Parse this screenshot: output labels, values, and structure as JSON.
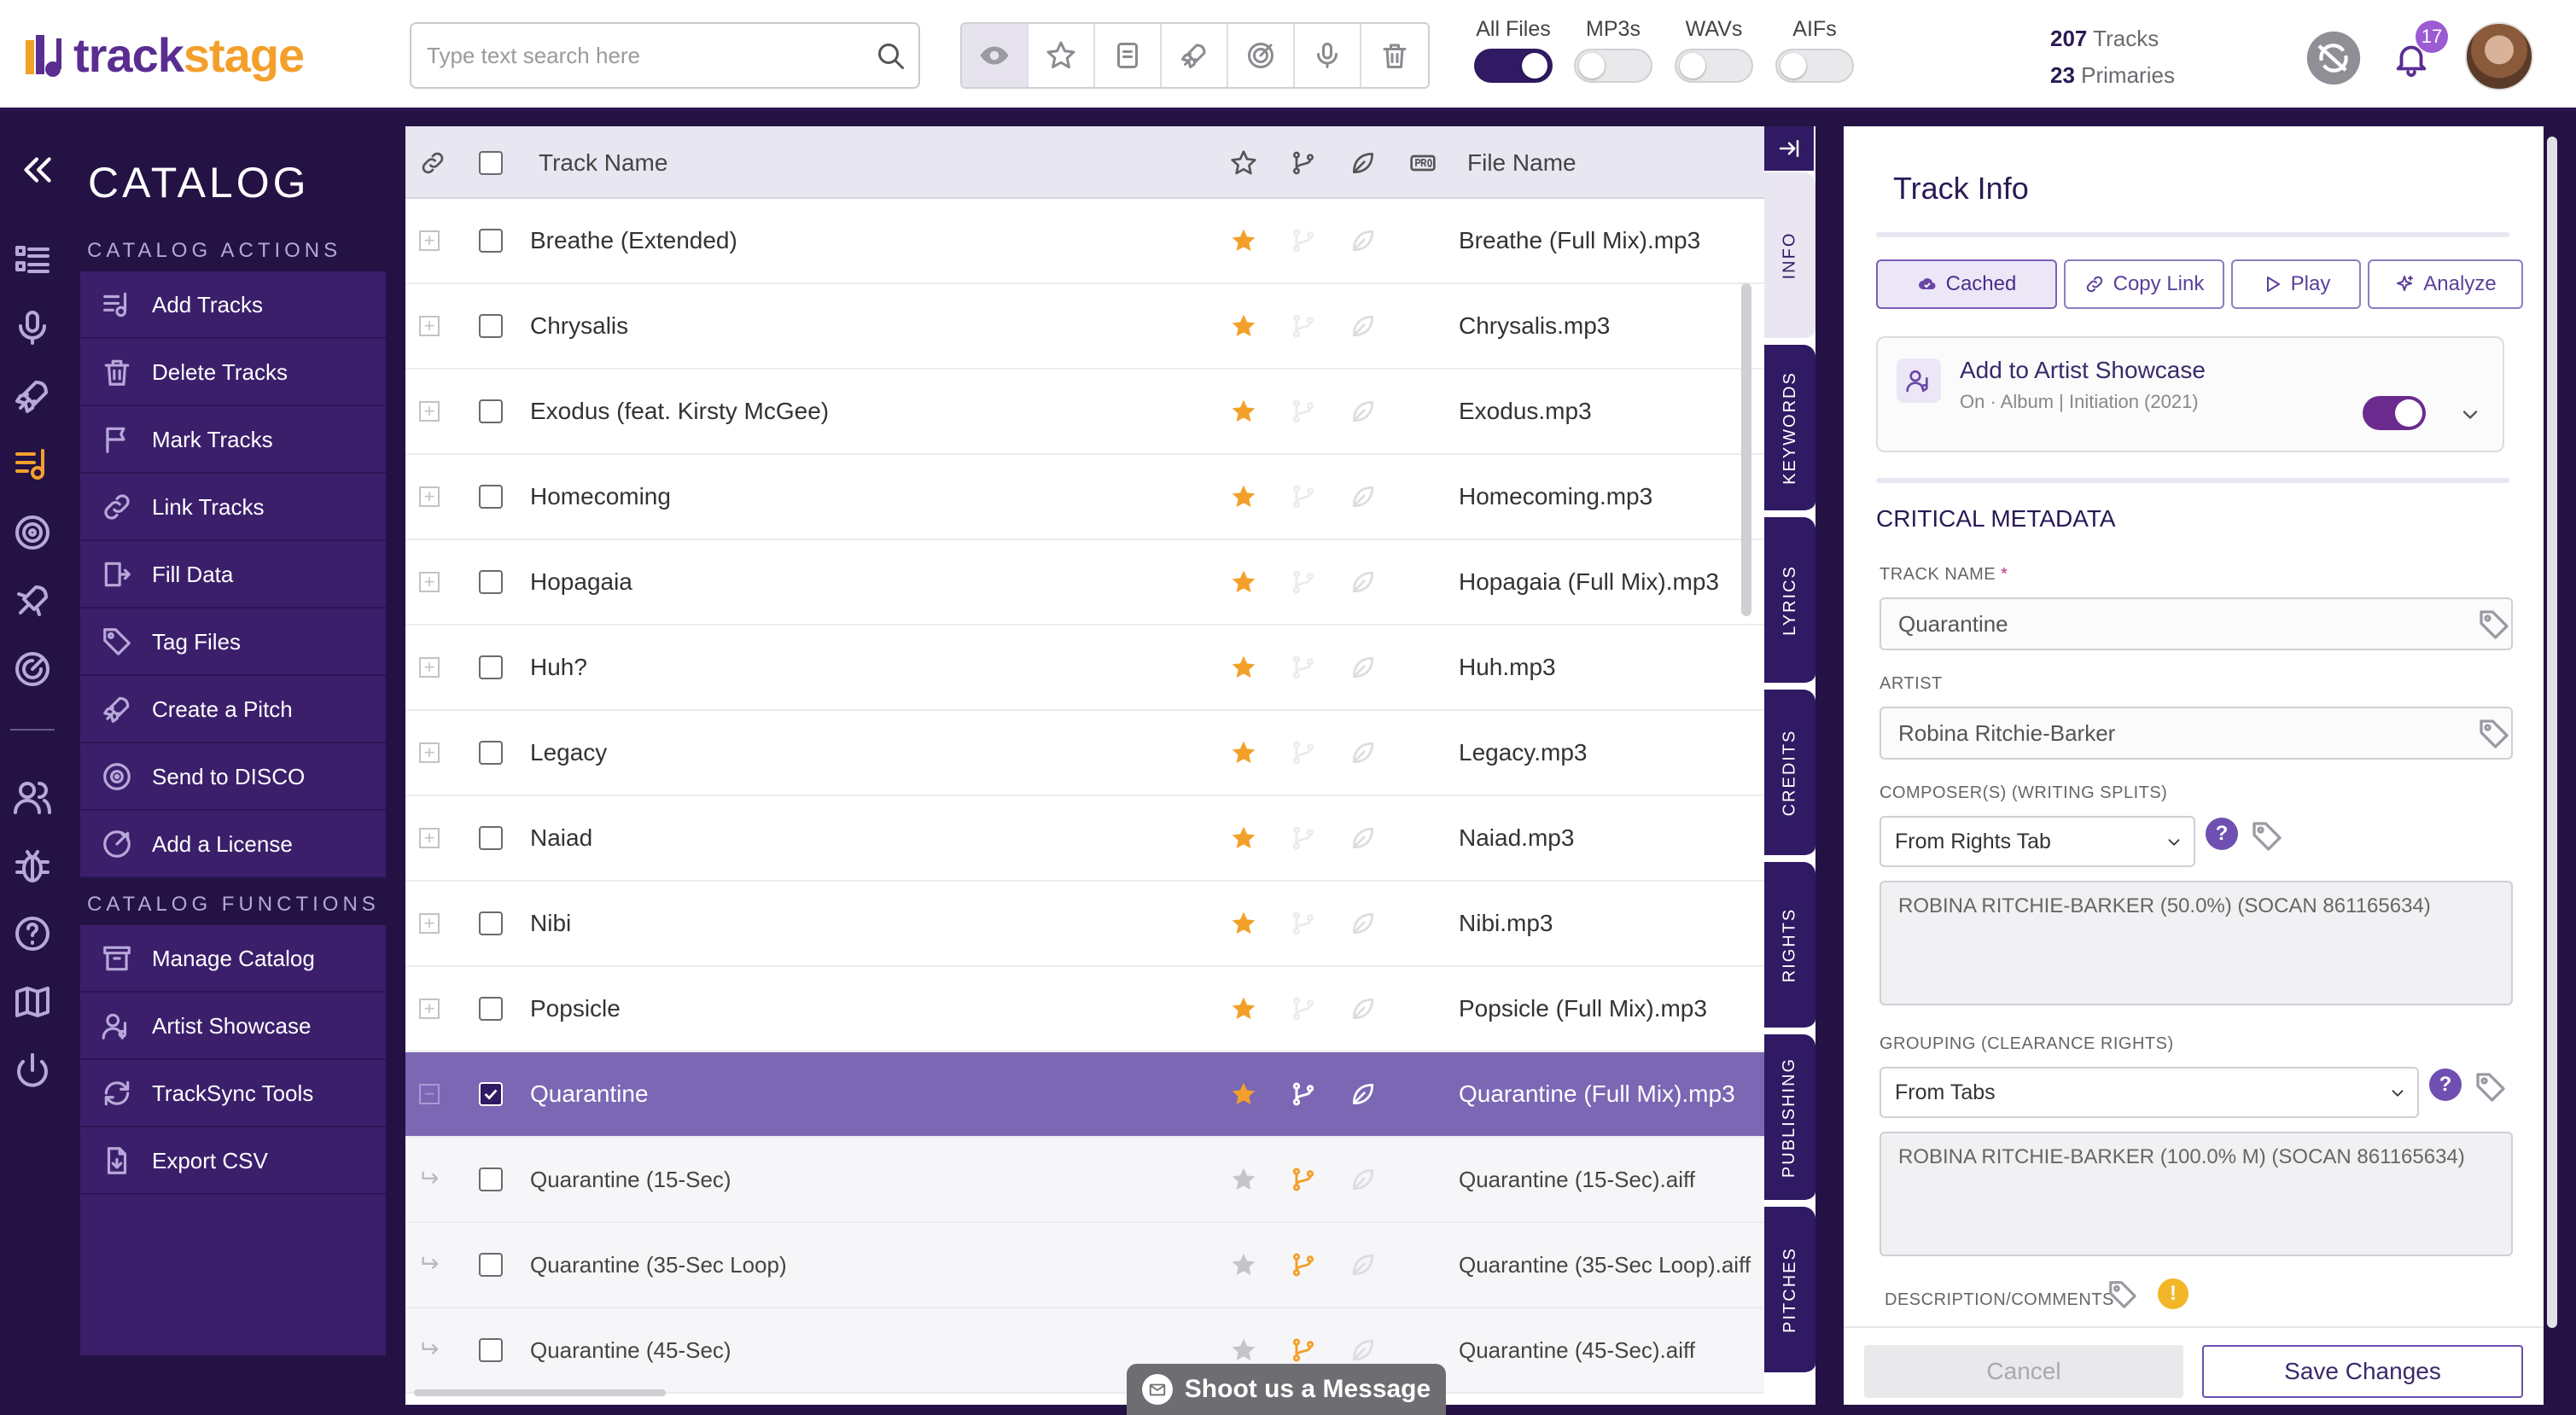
{
  "app": {
    "logo_text_a": "track",
    "logo_text_b": "stage",
    "brand_purple": "#2f1a63",
    "brand_orange": "#f3a02b"
  },
  "header": {
    "search_placeholder": "Type text search here",
    "filter_icons": [
      "eye-icon",
      "star-icon",
      "document-icon",
      "rocket-icon",
      "target-icon",
      "microphone-icon",
      "trash-icon"
    ],
    "file_toggles": [
      {
        "label": "All Files",
        "on": true
      },
      {
        "label": "MP3s",
        "on": false
      },
      {
        "label": "WAVs",
        "on": false
      },
      {
        "label": "AIFs",
        "on": false
      }
    ],
    "tracks_count": "207",
    "tracks_label": "Tracks",
    "primaries_count": "23",
    "primaries_label": "Primaries",
    "notification_count": "17"
  },
  "sidebar": {
    "title": "CATALOG",
    "actions_title": "CATALOG ACTIONS",
    "actions": [
      {
        "label": "Add Tracks",
        "icon": "add-tracks-icon"
      },
      {
        "label": "Delete Tracks",
        "icon": "delete-icon"
      },
      {
        "label": "Mark Tracks",
        "icon": "flag-icon"
      },
      {
        "label": "Link Tracks",
        "icon": "link-icon"
      },
      {
        "label": "Fill Data",
        "icon": "fill-data-icon"
      },
      {
        "label": "Tag Files",
        "icon": "tag-icon"
      },
      {
        "label": "Create a Pitch",
        "icon": "rocket-icon"
      },
      {
        "label": "Send to DISCO",
        "icon": "disco-icon"
      },
      {
        "label": "Add a License",
        "icon": "license-icon"
      }
    ],
    "functions_title": "CATALOG FUNCTIONS",
    "functions": [
      {
        "label": "Manage Catalog",
        "icon": "archive-icon"
      },
      {
        "label": "Artist Showcase",
        "icon": "artist-icon"
      },
      {
        "label": "TrackSync Tools",
        "icon": "sync-icon"
      },
      {
        "label": "Export CSV",
        "icon": "export-icon"
      }
    ]
  },
  "table": {
    "col_track": "Track Name",
    "col_file": "File Name",
    "rows": [
      {
        "name": "Breathe (Extended)",
        "file": "Breathe (Full Mix).mp3",
        "starred": true,
        "type": "parent"
      },
      {
        "name": "Chrysalis",
        "file": "Chrysalis.mp3",
        "starred": true,
        "type": "parent"
      },
      {
        "name": "Exodus (feat. Kirsty McGee)",
        "file": "Exodus.mp3",
        "starred": true,
        "type": "parent"
      },
      {
        "name": "Homecoming",
        "file": "Homecoming.mp3",
        "starred": true,
        "type": "parent"
      },
      {
        "name": "Hopagaia",
        "file": "Hopagaia (Full Mix).mp3",
        "starred": true,
        "type": "parent"
      },
      {
        "name": "Huh?",
        "file": "Huh.mp3",
        "starred": true,
        "type": "parent"
      },
      {
        "name": "Legacy",
        "file": "Legacy.mp3",
        "starred": true,
        "type": "parent"
      },
      {
        "name": "Naiad",
        "file": "Naiad.mp3",
        "starred": true,
        "type": "parent"
      },
      {
        "name": "Nibi",
        "file": "Nibi.mp3",
        "starred": true,
        "type": "parent"
      },
      {
        "name": "Popsicle",
        "file": "Popsicle (Full Mix).mp3",
        "starred": true,
        "type": "parent"
      },
      {
        "name": "Quarantine",
        "file": "Quarantine (Full Mix).mp3",
        "starred": true,
        "type": "selected"
      },
      {
        "name": "Quarantine (15-Sec)",
        "file": "Quarantine (15-Sec).aiff",
        "starred": false,
        "type": "child"
      },
      {
        "name": "Quarantine (35-Sec Loop)",
        "file": "Quarantine (35-Sec Loop).aiff",
        "starred": false,
        "type": "child"
      },
      {
        "name": "Quarantine (45-Sec)",
        "file": "Quarantine (45-Sec).aiff",
        "starred": false,
        "type": "child"
      }
    ]
  },
  "vtabs": [
    "INFO",
    "KEYWORDS",
    "LYRICS",
    "CREDITS",
    "RIGHTS",
    "PUBLISHING",
    "PITCHES"
  ],
  "panel": {
    "title": "Track Info",
    "btn_cached": "Cached",
    "btn_copy_link": "Copy Link",
    "btn_play": "Play",
    "btn_analyze": "Analyze",
    "showcase_title": "Add to Artist Showcase",
    "showcase_sub": "On · Album | Initiation (2021)",
    "critical_title": "CRITICAL METADATA",
    "track_name_label": "TRACK NAME",
    "required_mark": "*",
    "track_name_value": "Quarantine",
    "artist_label": "ARTIST",
    "artist_value": "Robina Ritchie-Barker",
    "composers_label": "COMPOSER(S) (WRITING SPLITS)",
    "composers_select": "From Rights Tab",
    "composers_value": "ROBINA RITCHIE-BARKER (50.0%) (SOCAN 861165634)",
    "grouping_label": "GROUPING (CLEARANCE RIGHTS)",
    "grouping_select": "From Tabs",
    "grouping_value": "ROBINA RITCHIE-BARKER (100.0% M) (SOCAN 861165634)",
    "description_label": "DESCRIPTION/COMMENTS",
    "help_glyph": "?",
    "warn_glyph": "!",
    "cancel_label": "Cancel",
    "save_label": "Save Changes"
  },
  "chat": {
    "label": "Shoot us a Message"
  }
}
